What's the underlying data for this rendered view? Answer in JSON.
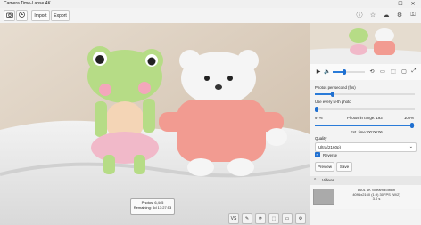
{
  "app": {
    "title": "Camera Time-Lapse 4K"
  },
  "window": {
    "minimize": "—",
    "maximize": "☐",
    "close": "✕"
  },
  "toolbar": {
    "import_label": "Import",
    "export_label": "Export"
  },
  "viewer": {
    "photos_label": "Photos: 6,445",
    "remaining_label": "Remaining: 5d 13:27:53",
    "vs_label": "VS"
  },
  "player": {
    "position_fraction": 0.35
  },
  "settings": {
    "fps_label": "Photos per second (fps)",
    "fps_fraction": 0.18,
    "nth_label": "Use every N-th photo",
    "nth_fraction": 0.02,
    "range_start": "97%",
    "range_label": "Photos in range: 193",
    "range_end": "100%",
    "range_fraction": 0.97,
    "est_time_label": "Est. time: 00:00:06",
    "quality_label": "Quality",
    "quality_value": "Ultra(2160p)",
    "reverse_label": "Reverse",
    "preview_label": "Preview",
    "save_label": "Save"
  },
  "videos": {
    "section_label": "Videos",
    "item_title": "8601 4K Stream Edition",
    "item_details": "4096x2160 (1:9) 30FPS (W/2)",
    "item_sub": "3.0 s"
  },
  "colors": {
    "accent": "#1f6fd0",
    "panel_bg": "#f3f3f3"
  }
}
